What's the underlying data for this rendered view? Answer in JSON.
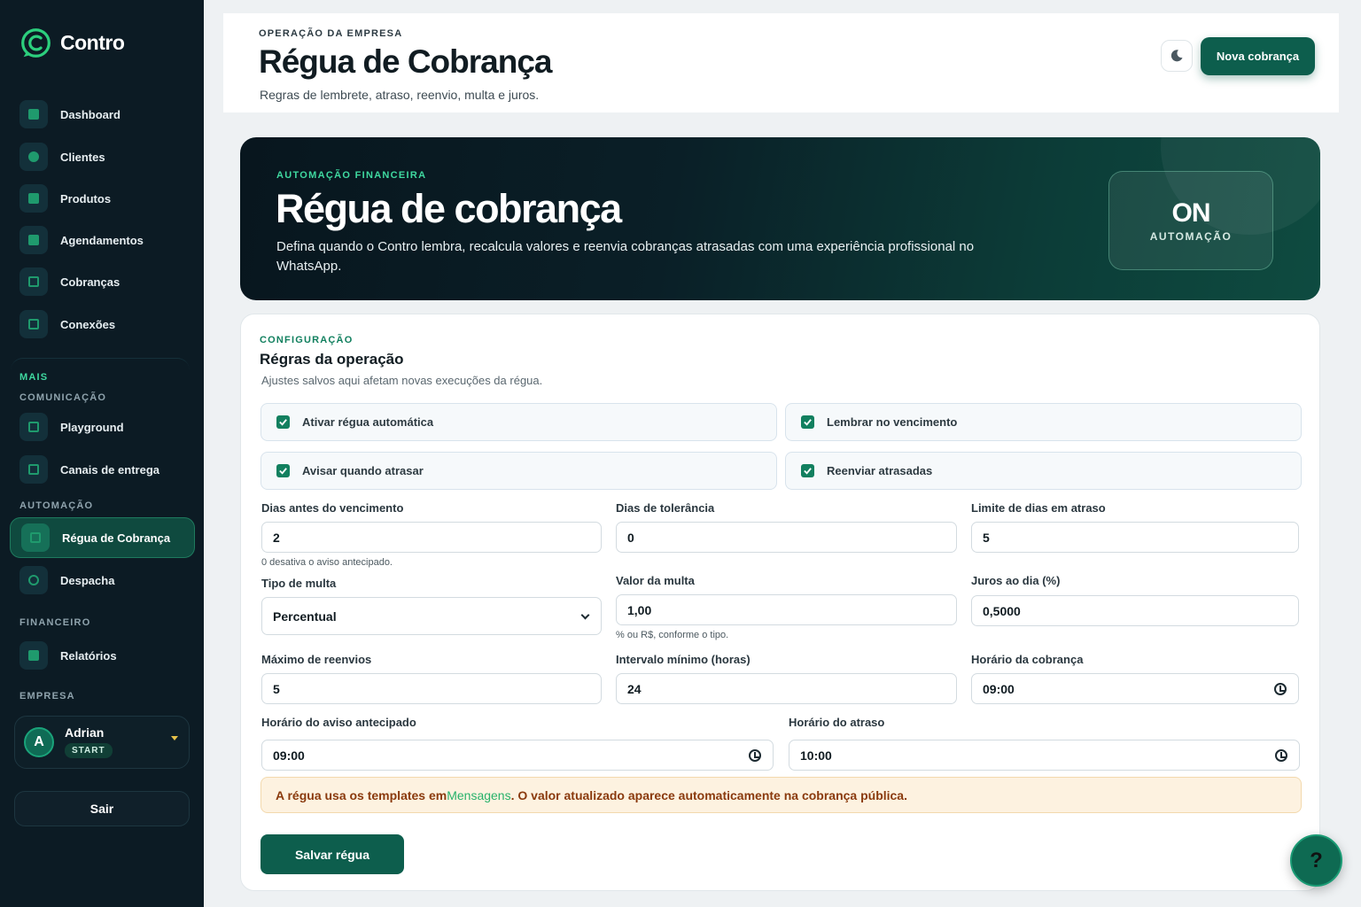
{
  "app": {
    "name": "Contro"
  },
  "sidebar": {
    "items": [
      {
        "label": "Dashboard",
        "icon": "dashboard-icon"
      },
      {
        "label": "Clientes",
        "icon": "users-icon"
      },
      {
        "label": "Produtos",
        "icon": "box-icon"
      },
      {
        "label": "Agendamentos",
        "icon": "calendar-icon"
      },
      {
        "label": "Cobranças",
        "icon": "invoice-icon"
      },
      {
        "label": "Conexões",
        "icon": "connection-icon"
      }
    ],
    "more_label": "MAIS",
    "sections": {
      "comunicacao": {
        "title": "COMUNICAÇÃO",
        "items": [
          {
            "label": "Playground"
          },
          {
            "label": "Canais de entrega"
          }
        ]
      },
      "automacao": {
        "title": "AUTOMAÇÃO",
        "items": [
          {
            "label": "Régua de Cobrança"
          },
          {
            "label": "Despacha"
          }
        ]
      },
      "financeiro": {
        "title": "FINANCEIRO",
        "items": [
          {
            "label": "Relatórios"
          }
        ]
      },
      "empresa": {
        "title": "EMPRESA"
      }
    },
    "user": {
      "initial": "A",
      "name": "Adrian",
      "plan": "START"
    },
    "logout_label": "Sair"
  },
  "header": {
    "eyebrow": "OPERAÇÃO DA EMPRESA",
    "title": "Régua de Cobrança",
    "subtitle": "Regras de lembrete, atraso, reenvio, multa e juros.",
    "new_button": "Nova cobrança"
  },
  "hero": {
    "eyebrow": "AUTOMAÇÃO FINANCEIRA",
    "title": "Régua de cobrança",
    "description": "Defina quando o Contro lembra, recalcula valores e reenvia cobranças atrasadas com uma experiência profissional no WhatsApp.",
    "status_value": "ON",
    "status_label": "AUTOMAÇÃO"
  },
  "config": {
    "eyebrow": "CONFIGURAÇÃO",
    "title": "Régras da operação",
    "subtitle": "Ajustes salvos aqui afetam novas execuções da régua.",
    "checkboxes": [
      {
        "label": "Ativar régua automática",
        "checked": true
      },
      {
        "label": "Lembrar no vencimento",
        "checked": true
      },
      {
        "label": "Avisar quando atrasar",
        "checked": true
      },
      {
        "label": "Reenviar atrasadas",
        "checked": true
      }
    ],
    "fields": {
      "dias_antes": {
        "label": "Dias antes do vencimento",
        "value": "2",
        "help": "0 desativa o aviso antecipado."
      },
      "dias_tolerancia": {
        "label": "Dias de tolerância",
        "value": "0"
      },
      "limite_atraso": {
        "label": "Limite de dias em atraso",
        "value": "5"
      },
      "tipo_multa": {
        "label": "Tipo de multa",
        "value": "Percentual"
      },
      "valor_multa": {
        "label": "Valor da multa",
        "value": "1,00",
        "help": "% ou R$, conforme o tipo."
      },
      "juros_dia": {
        "label": "Juros ao dia (%)",
        "value": "0,5000"
      },
      "max_reenvios": {
        "label": "Máximo de reenvios",
        "value": "5"
      },
      "intervalo": {
        "label": "Intervalo mínimo (horas)",
        "value": "24"
      },
      "horario_cobranca": {
        "label": "Horário da cobrança",
        "value": "09:00"
      },
      "horario_aviso": {
        "label": "Horário do aviso antecipado",
        "value": "09:00"
      },
      "horario_atraso": {
        "label": "Horário do atraso",
        "value": "10:00"
      }
    },
    "notice": {
      "prefix": "A régua usa os templates em ",
      "link": "Mensagens",
      "suffix": ". O valor atualizado aparece automaticamente na cobrança pública."
    },
    "save_button": "Salvar régua"
  },
  "help_button": "?",
  "colors": {
    "accent": "#0d5e4d",
    "sidebar_bg": "#0c1b24",
    "link": "#27b26a"
  }
}
